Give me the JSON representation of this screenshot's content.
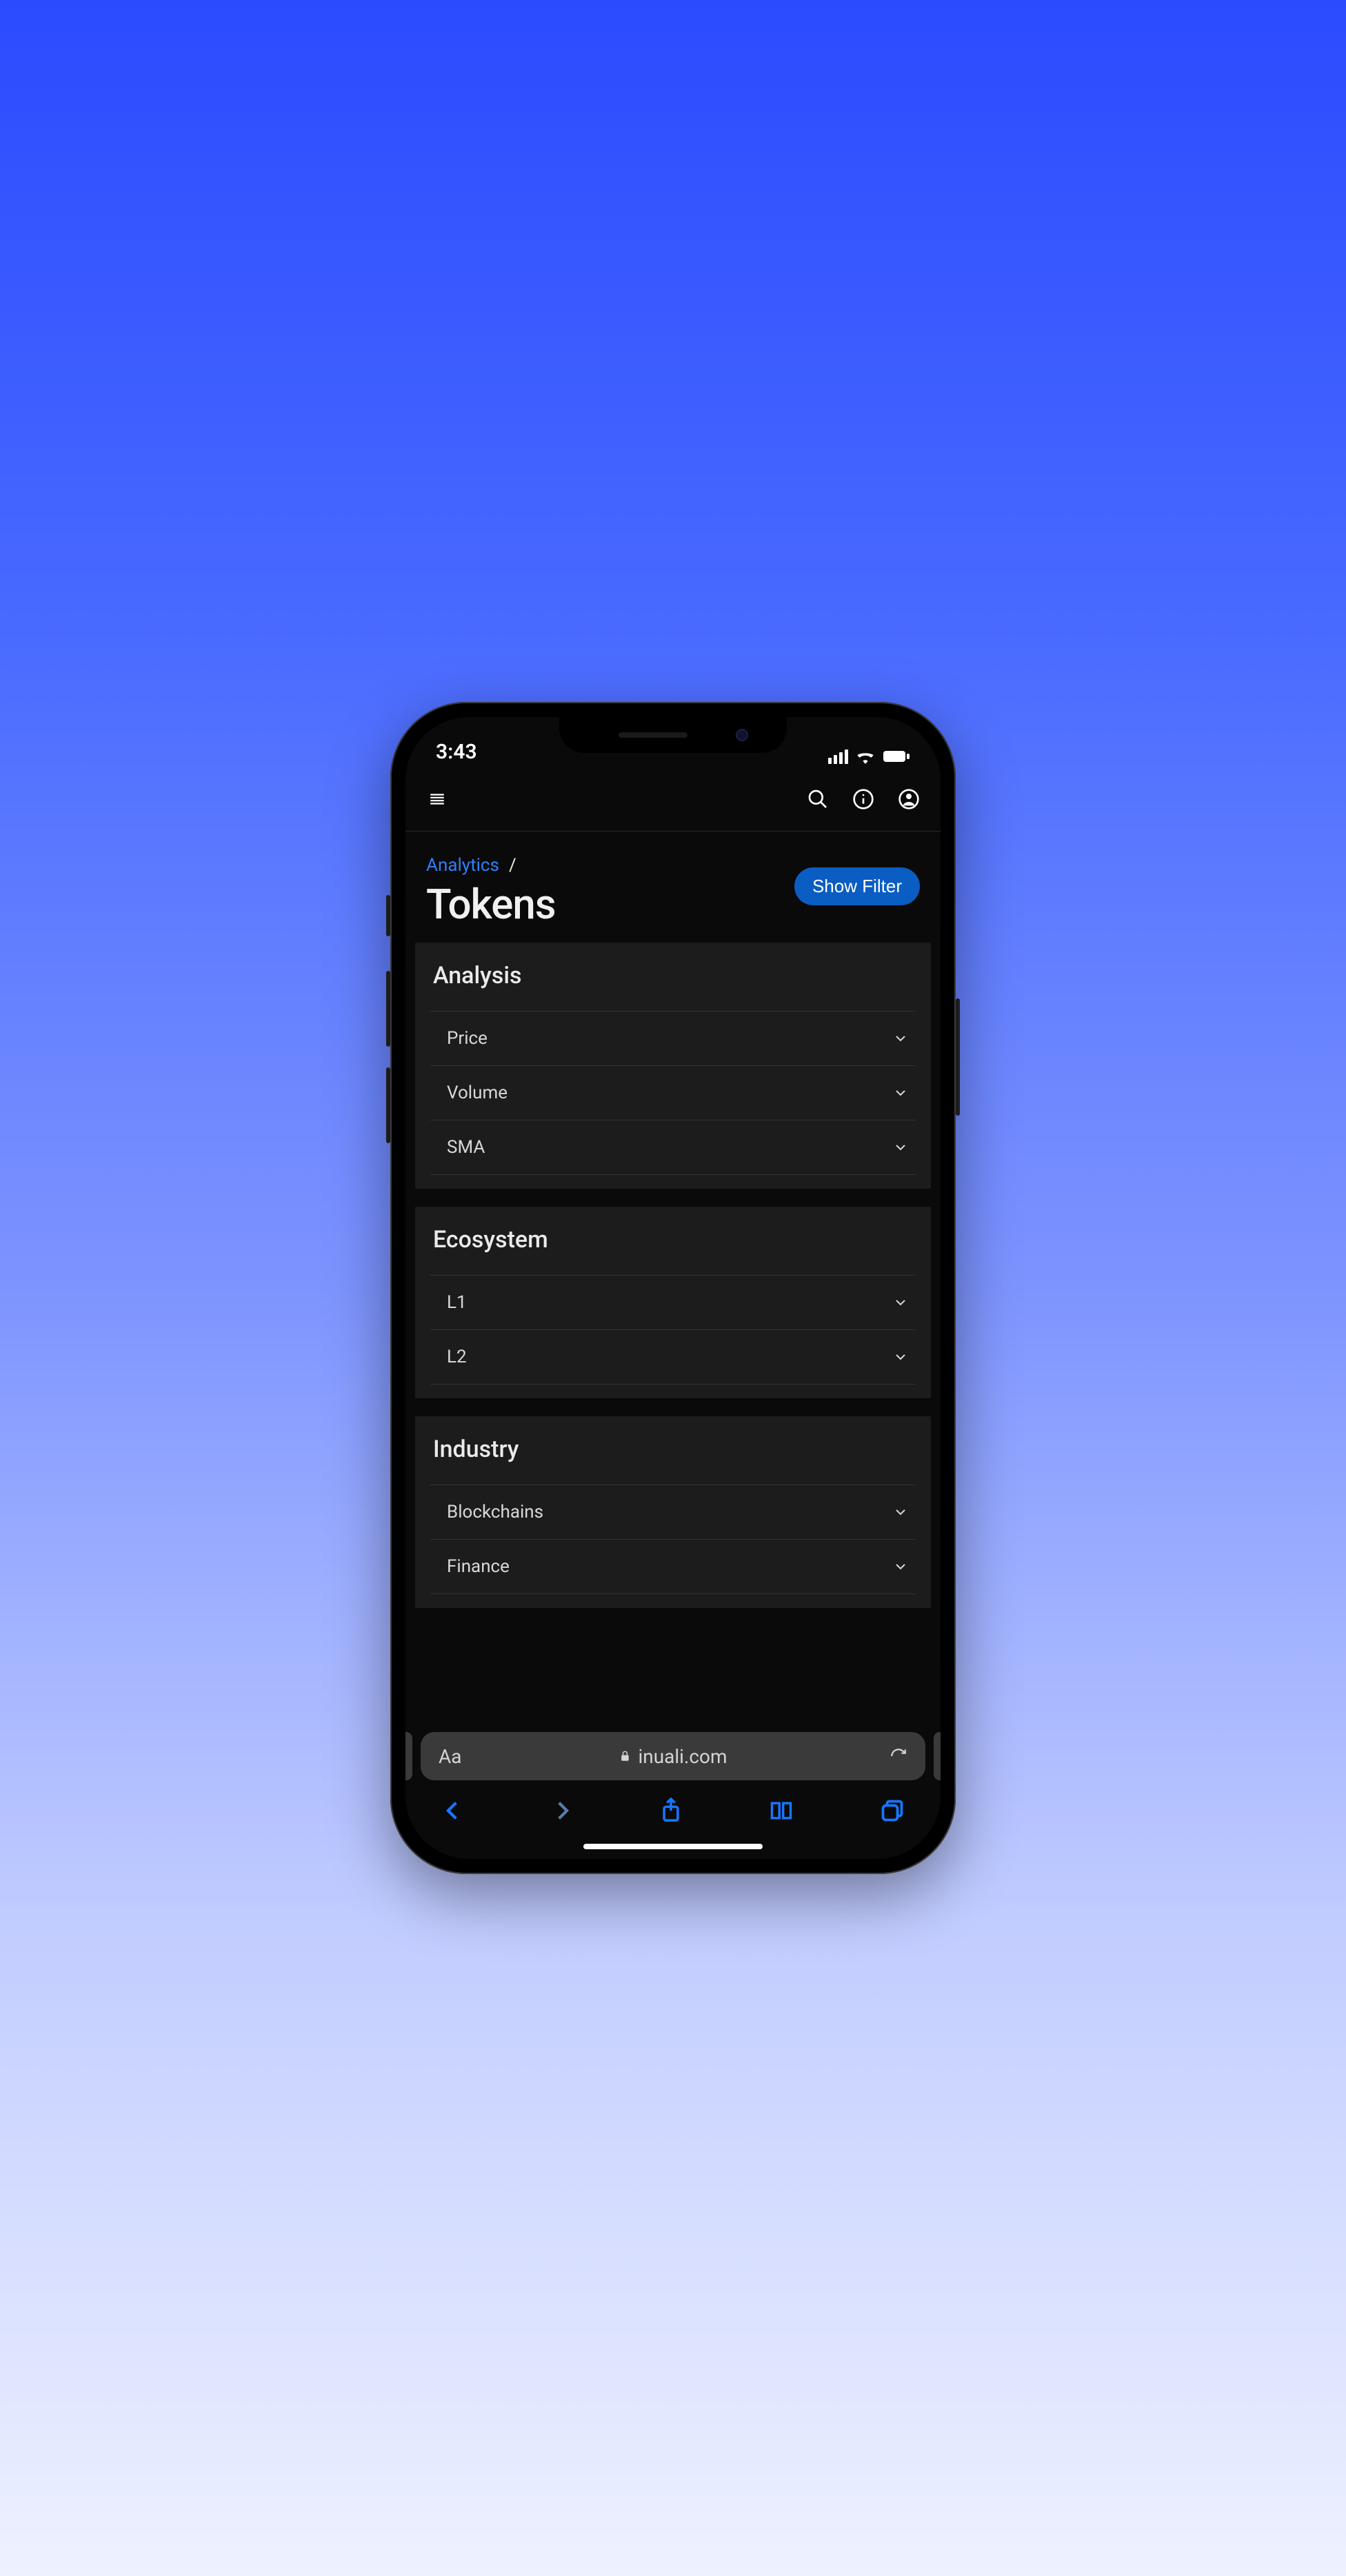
{
  "status": {
    "time": "3:43"
  },
  "breadcrumb": {
    "root": "Analytics",
    "sep": "/"
  },
  "page": {
    "title": "Tokens",
    "filter_button": "Show Filter"
  },
  "panels": [
    {
      "title": "Analysis",
      "rows": [
        "Price",
        "Volume",
        "SMA"
      ]
    },
    {
      "title": "Ecosystem",
      "rows": [
        "L1",
        "L2"
      ]
    },
    {
      "title": "Industry",
      "rows": [
        "Blockchains",
        "Finance"
      ]
    }
  ],
  "browser": {
    "aa": "Aa",
    "domain": "inuali.com"
  }
}
